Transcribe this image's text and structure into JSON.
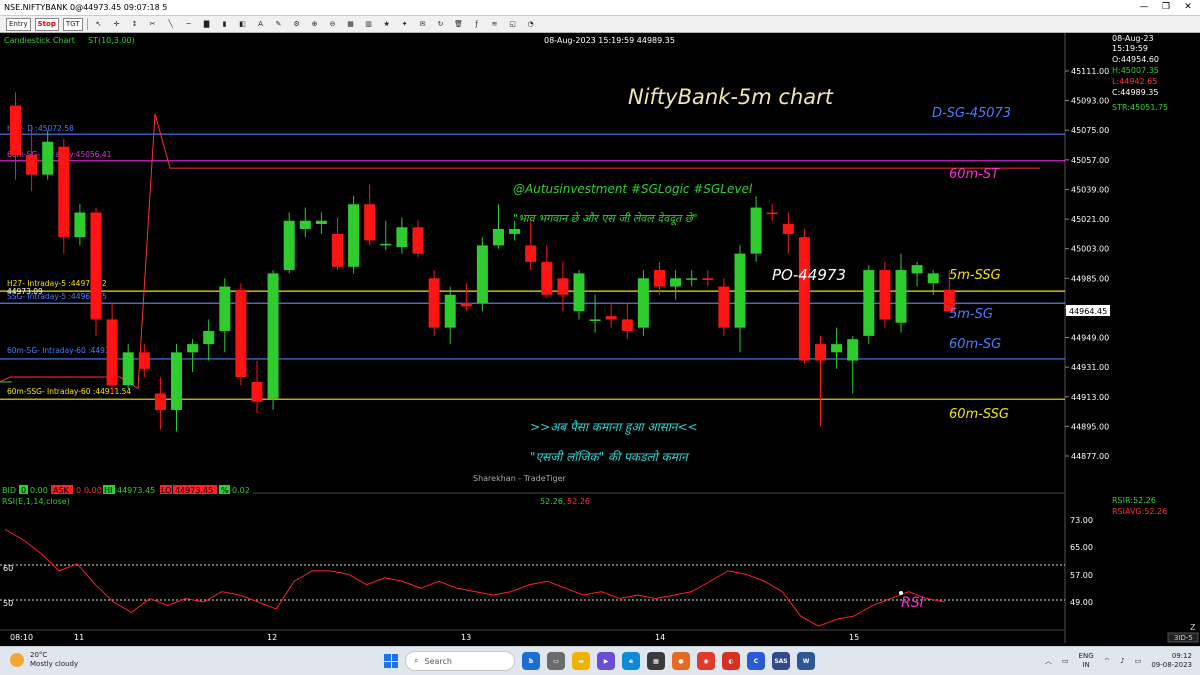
{
  "window": {
    "title": "NSE.NIFTYBANK 0@44973.45 09:07:18 5",
    "controls": [
      "—",
      "❐",
      "✕"
    ]
  },
  "toolbar": {
    "entry_label": "Entry",
    "stop_label": "Stop",
    "tgt_label": "TGT"
  },
  "chart": {
    "type_label": "Candlestick Chart",
    "indicator_label": "ST(10,3.00)",
    "cursor_datetime": "08-Aug-2023  15:19:59  44989.35",
    "title": "NiftyBank-5m chart",
    "watermark": "Sharekhan - TradeTiger",
    "info_panel": {
      "date": "08-Aug-23",
      "time": "15:19:59",
      "open": "O:44954.60",
      "high": "H:45007.35",
      "low": "L:44942.65",
      "close": "C:44989.35",
      "str": "STR:45051.75"
    },
    "current_price": "44964.45",
    "price_ticks": [
      "45111.00",
      "45093.00",
      "45075.00",
      "45057.00",
      "45039.00",
      "45021.00",
      "45003.00",
      "44985.00",
      "44967.00",
      "44949.00",
      "44931.00",
      "44913.00",
      "44895.00",
      "44877.00"
    ],
    "level_labels": {
      "h19": "H19- D :45072.58",
      "sg60": "60m-SG- Intraday:45056.41",
      "h27": "H27- Intraday-5 :44977.22",
      "h27_overlap": "44973.09",
      "ssg5": "SSG- Intraday-5 :44969.85",
      "sg60_low": "60m-SG- Intraday-60 :44936.",
      "ssg60": "60m-SSG- Intraday-60 :44911.54"
    },
    "right_annotations": {
      "dsg": "D-SG-45073",
      "st60": "60m-ST",
      "ssg5m": "5m-SSG",
      "sg5m": "5m-SG",
      "sg60m": "60m-SG",
      "ssg60m": "60m-SSG"
    },
    "po_label": "PO-44973",
    "overlay_text": {
      "handles": "@Autusinvestment  #SGLogic  #SGLevel",
      "quote": "\"भाव भगवान छे और एस जी लेवल देवदूत छे\"",
      "line1": ">>अब पैसा कमाना हुआ आसान<<",
      "line2": "\"एसजी लॉजिक\" की पकडलो कमान"
    }
  },
  "quote_bar": {
    "bid_label": "BID",
    "bid_value": "0",
    "bid_value2": "0.00",
    "ask_label": "ASK",
    "ask_value": "0",
    "ask_value2": "0.00",
    "hi_label": "HI",
    "hi_value": "44973.45",
    "lo_label": "LO",
    "lo_value": "44973.45",
    "pct_label": "%",
    "pct_value": "0.02"
  },
  "rsi": {
    "label": "RSI(E,1,14,close)",
    "value_text": "52.26,",
    "value_text2": "52.26",
    "rsir": "RSIR:52.26",
    "rsiavg": "RSIAVG:52.26",
    "ticks": [
      "73.00",
      "65.00",
      "57.00",
      "49.00"
    ],
    "left_levels": [
      "60",
      "50"
    ],
    "annotation": "RSI"
  },
  "time_axis": {
    "labels": [
      "08:10",
      "11",
      "12",
      "13",
      "14",
      "15"
    ],
    "scroll_label": "3ID-5",
    "corner": "Z"
  },
  "chart_data": {
    "type": "candlestick",
    "candles": [
      [
        45090,
        45098,
        45045,
        45060
      ],
      [
        45060,
        45078,
        45038,
        45048
      ],
      [
        45048,
        45075,
        45045,
        45068
      ],
      [
        45065,
        45070,
        45000,
        45010
      ],
      [
        45010,
        45030,
        45005,
        45025
      ],
      [
        45025,
        45028,
        44950,
        44960
      ],
      [
        44960,
        44970,
        44915,
        44920
      ],
      [
        44920,
        44945,
        44918,
        44940
      ],
      [
        44940,
        44945,
        44925,
        44930
      ],
      [
        44915,
        44925,
        44893,
        44905
      ],
      [
        44905,
        44945,
        44892,
        44940
      ],
      [
        44940,
        44948,
        44928,
        44945
      ],
      [
        44945,
        44960,
        44935,
        44953
      ],
      [
        44953,
        44985,
        44940,
        44980
      ],
      [
        44978,
        44982,
        44920,
        44925
      ],
      [
        44922,
        44935,
        44903,
        44910
      ],
      [
        44912,
        44990,
        44905,
        44988
      ],
      [
        44990,
        45025,
        44988,
        45020
      ],
      [
        45015,
        45028,
        45010,
        45020
      ],
      [
        45018,
        45025,
        45012,
        45020
      ],
      [
        45012,
        45022,
        44990,
        44992
      ],
      [
        44992,
        45035,
        44988,
        45030
      ],
      [
        45030,
        45042,
        45005,
        45008
      ],
      [
        45005,
        45020,
        45002,
        45006
      ],
      [
        45004,
        45022,
        45000,
        45016
      ],
      [
        45016,
        45020,
        44998,
        45000
      ],
      [
        44985,
        44990,
        44950,
        44955
      ],
      [
        44955,
        44980,
        44945,
        44975
      ],
      [
        44970,
        44982,
        44965,
        44968
      ],
      [
        44970,
        45010,
        44965,
        45005
      ],
      [
        45005,
        45030,
        45003,
        45015
      ],
      [
        45012,
        45020,
        45008,
        45015
      ],
      [
        45005,
        45022,
        44990,
        44995
      ],
      [
        44995,
        45005,
        44973,
        44975
      ],
      [
        44985,
        44995,
        44965,
        44975
      ],
      [
        44965,
        44990,
        44960,
        44988
      ],
      [
        44960,
        44975,
        44952,
        44960
      ],
      [
        44962,
        44970,
        44955,
        44960
      ],
      [
        44960,
        44970,
        44948,
        44953
      ],
      [
        44955,
        44990,
        44950,
        44985
      ],
      [
        44990,
        44995,
        44975,
        44980
      ],
      [
        44980,
        44990,
        44972,
        44985
      ],
      [
        44985,
        44990,
        44980,
        44985
      ],
      [
        44985,
        44990,
        44980,
        44984
      ],
      [
        44980,
        44985,
        44950,
        44955
      ],
      [
        44955,
        45005,
        44940,
        45000
      ],
      [
        45000,
        45035,
        44995,
        45028
      ],
      [
        45025,
        45030,
        45020,
        45024
      ],
      [
        45018,
        45025,
        45000,
        45012
      ],
      [
        45010,
        45015,
        44933,
        44935
      ],
      [
        44945,
        44950,
        44895,
        44935
      ],
      [
        44940,
        44955,
        44930,
        44945
      ],
      [
        44935,
        44950,
        44915,
        44948
      ],
      [
        44950,
        44993,
        44945,
        44990
      ],
      [
        44990,
        44995,
        44955,
        44960
      ],
      [
        44958,
        45000,
        44952,
        44990
      ],
      [
        44988,
        44995,
        44980,
        44993
      ],
      [
        44982,
        44990,
        44975,
        44988
      ],
      [
        44978,
        44990,
        44964,
        44965
      ]
    ],
    "rsi_values": [
      70,
      67,
      63,
      58,
      60,
      54,
      49,
      46,
      50,
      48,
      50,
      49,
      52,
      51,
      49,
      47,
      55,
      58,
      58,
      57,
      54,
      56,
      55,
      53,
      55,
      53,
      52,
      51,
      52,
      54,
      55,
      53,
      51,
      52,
      50,
      51,
      50,
      51,
      52,
      55,
      58,
      57,
      55,
      52,
      45,
      42,
      44,
      45,
      48,
      50,
      52,
      50,
      49
    ]
  }
}
